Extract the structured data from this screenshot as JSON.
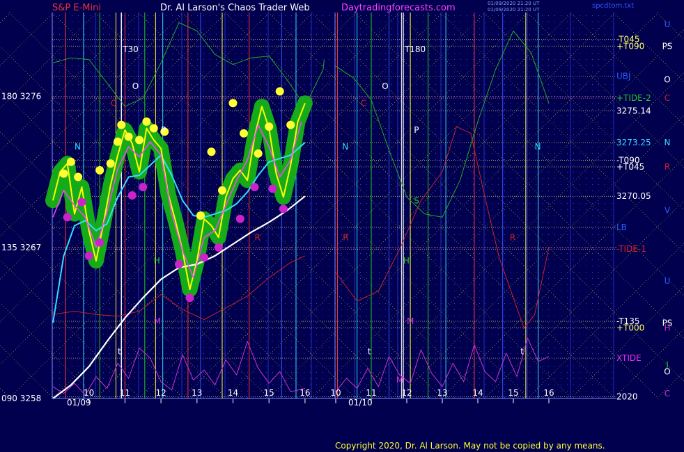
{
  "header": {
    "instrument": "S&P E-Mini",
    "site_title": "Dr. Al Larson's Chaos Trader Web",
    "site_url": "Daytradingforecasts.com",
    "timestamp_1": "01/09/2020 21:20 UT",
    "timestamp_2": "01/09/2020 21:20 UT",
    "spec_file": "spcdtom.txt"
  },
  "footer": {
    "copyright": "Copyright 2020, Dr. Al Larson. May not be copied by any means."
  },
  "colors": {
    "background": "#00004e",
    "grid_dot": "#3a46d8",
    "price": "#ffff00",
    "ma_fast": "#ff44ff",
    "ma_slow": "#33ddff",
    "long_ma": "#ffffff",
    "green_line": "#22aa22",
    "red_line": "#cc2222",
    "xtide": "#cc33cc",
    "dots_high": "#ffff33",
    "dots_low": "#cc22cc",
    "halo": "#16b316"
  },
  "chart_data": {
    "type": "line",
    "title": "S&P E-Mini",
    "xlabel": "",
    "ylabel": "",
    "ylim": [
      3258,
      3281
    ],
    "x_days": [
      "01/09",
      "01/10"
    ],
    "x_ticks": [
      {
        "label": "10",
        "x": 10
      },
      {
        "label": "11",
        "x": 11
      },
      {
        "label": "12",
        "x": 12
      },
      {
        "label": "13",
        "x": 13
      },
      {
        "label": "14",
        "x": 14
      },
      {
        "label": "15",
        "x": 15
      },
      {
        "label": "16",
        "x": 16
      },
      {
        "label": "10",
        "x": 26
      },
      {
        "label": "11",
        "x": 27
      },
      {
        "label": "12",
        "x": 28
      },
      {
        "label": "13",
        "x": 29
      },
      {
        "label": "14",
        "x": 30
      },
      {
        "label": "15",
        "x": 31
      },
      {
        "label": "16",
        "x": 32
      }
    ],
    "y_ticks": [
      {
        "label": "180  3276",
        "value": 3276
      },
      {
        "label": "135  3267",
        "value": 3267
      },
      {
        "label": "090  3258",
        "value": 3258
      }
    ],
    "vertical_labels": [
      {
        "label": "T30",
        "x": 10.9
      },
      {
        "label": "T180",
        "x": 27.9
      }
    ],
    "right_labels": [
      {
        "label": "-T045",
        "value": 3279.4,
        "color": "#ffff66"
      },
      {
        "label": "+T090",
        "value": 3279.0,
        "color": "#ffff66"
      },
      {
        "label": "UBJ",
        "value": 3277.2,
        "color": "#2a5cff"
      },
      {
        "label": "+TIDE-2",
        "value": 3275.9,
        "color": "#22cc22"
      },
      {
        "label": "3275.14",
        "value": 3275.14,
        "color": "#ffffff"
      },
      {
        "label": "3273.25",
        "value": 3273.25,
        "color": "#33ddff"
      },
      {
        "label": "-T090",
        "value": 3272.2,
        "color": "#ffffff"
      },
      {
        "label": "+T045",
        "value": 3271.8,
        "color": "#ffffff"
      },
      {
        "label": "3270.05",
        "value": 3270.05,
        "color": "#ffffff"
      },
      {
        "label": "LB",
        "value": 3268.2,
        "color": "#2a5cff"
      },
      {
        "label": "-TIDE-1",
        "value": 3266.9,
        "color": "#ee2222"
      },
      {
        "label": "-T135",
        "value": 3262.6,
        "color": "#ffffff"
      },
      {
        "label": "+T000",
        "value": 3262.2,
        "color": "#ffff66"
      },
      {
        "label": "XTIDE",
        "value": 3260.4,
        "color": "#ee33ee"
      },
      {
        "label": "2020",
        "value": 3258.1,
        "color": "#ffffff"
      }
    ],
    "far_right_labels": [
      {
        "label": "U",
        "value": 3280.3,
        "color": "#2a5cff"
      },
      {
        "label": "PS",
        "value": 3279.0,
        "color": "#ffffff"
      },
      {
        "label": "O",
        "value": 3277.0,
        "color": "#ffffff"
      },
      {
        "label": "C",
        "value": 3275.9,
        "color": "#cc2222"
      },
      {
        "label": "N",
        "value": 3273.25,
        "color": "#33ddff"
      },
      {
        "label": "R",
        "value": 3271.8,
        "color": "#cc2222"
      },
      {
        "label": "V",
        "value": 3269.2,
        "color": "#2a5cff"
      },
      {
        "label": "U",
        "value": 3265.0,
        "color": "#2a5cff"
      },
      {
        "label": "PS",
        "value": 3262.5,
        "color": "#ffffff"
      },
      {
        "label": "H",
        "value": 3262.2,
        "color": "#cc33cc"
      },
      {
        "label": "J",
        "value": 3260.0,
        "color": "#22cc22"
      },
      {
        "label": "O",
        "value": 3259.6,
        "color": "#ffffff"
      },
      {
        "label": "C",
        "value": 3258.3,
        "color": "#cc33cc"
      }
    ],
    "plot_letters": [
      {
        "label": "O",
        "x": 11.2,
        "value": 3276.6,
        "color": "#ffffff"
      },
      {
        "label": "P",
        "x": 12.0,
        "value": 3274.0,
        "color": "#ffffff"
      },
      {
        "label": "N",
        "x": 9.6,
        "value": 3273.0,
        "color": "#33ddff"
      },
      {
        "label": "C",
        "x": 10.6,
        "value": 3275.6,
        "color": "#cc2222"
      },
      {
        "label": "H",
        "x": 11.8,
        "value": 3266.2,
        "color": "#22cc22"
      },
      {
        "label": "M",
        "x": 11.8,
        "value": 3262.6,
        "color": "#cc33cc"
      },
      {
        "label": "R",
        "x": 14.6,
        "value": 3267.6,
        "color": "#cc2222"
      },
      {
        "label": "t",
        "x": 10.8,
        "value": 3260.8,
        "color": "#ffffff"
      },
      {
        "label": "O",
        "x": 27.3,
        "value": 3276.6,
        "color": "#ffffff"
      },
      {
        "label": "P",
        "x": 28.2,
        "value": 3274.0,
        "color": "#ffffff"
      },
      {
        "label": "N",
        "x": 25.6,
        "value": 3273.0,
        "color": "#33ddff"
      },
      {
        "label": "C",
        "x": 26.7,
        "value": 3275.6,
        "color": "#cc2222"
      },
      {
        "label": "S",
        "x": 28.2,
        "value": 3269.8,
        "color": "#22cc22"
      },
      {
        "label": "H",
        "x": 27.9,
        "value": 3266.2,
        "color": "#22cc22"
      },
      {
        "label": "M",
        "x": 28.0,
        "value": 3262.6,
        "color": "#cc33cc"
      },
      {
        "label": "R",
        "x": 25.9,
        "value": 3267.6,
        "color": "#cc2222"
      },
      {
        "label": "R",
        "x": 30.9,
        "value": 3267.6,
        "color": "#cc2222"
      },
      {
        "label": "t",
        "x": 31.2,
        "value": 3260.8,
        "color": "#ffffff"
      },
      {
        "label": "N",
        "x": 31.6,
        "value": 3273.0,
        "color": "#33ddff"
      },
      {
        "label": "t",
        "x": 26.9,
        "value": 3260.8,
        "color": "#ffffff"
      },
      {
        "label": "M",
        "x": 27.7,
        "value": 3259.1,
        "color": "#cc33cc"
      }
    ],
    "series": [
      {
        "name": "price",
        "x": [
          9.0,
          9.2,
          9.4,
          9.6,
          9.8,
          10.0,
          10.2,
          10.4,
          10.6,
          10.8,
          11.0,
          11.2,
          11.4,
          11.6,
          11.8,
          12.0,
          12.2,
          12.4,
          12.6,
          12.8,
          13.0,
          13.2,
          13.4,
          13.6,
          13.8,
          14.0,
          14.2,
          14.4,
          14.6,
          14.8,
          15.0,
          15.2,
          15.4,
          15.6,
          15.8,
          16.0
        ],
        "values": [
          3269.8,
          3271.5,
          3272.0,
          3269.0,
          3270.6,
          3268.0,
          3266.2,
          3268.4,
          3270.7,
          3272.5,
          3274.0,
          3273.2,
          3271.5,
          3274.1,
          3273.4,
          3272.9,
          3270.2,
          3268.6,
          3266.8,
          3264.5,
          3266.2,
          3268.7,
          3268.3,
          3267.6,
          3270.0,
          3271.1,
          3271.6,
          3271.0,
          3273.6,
          3275.4,
          3274.1,
          3271.4,
          3270.0,
          3271.9,
          3274.5,
          3275.6
        ]
      },
      {
        "name": "ma_fast",
        "x": [
          9.0,
          9.3,
          9.6,
          9.9,
          10.2,
          10.5,
          10.8,
          11.1,
          11.4,
          11.7,
          12.0,
          12.3,
          12.6,
          12.9,
          13.2,
          13.5,
          13.8,
          14.1,
          14.4,
          14.7,
          15.0,
          15.3,
          15.6,
          15.9
        ],
        "values": [
          3268.8,
          3270.4,
          3269.5,
          3268.8,
          3267.0,
          3269.1,
          3271.7,
          3273.0,
          3272.4,
          3273.3,
          3272.5,
          3269.0,
          3266.8,
          3265.2,
          3267.6,
          3268.0,
          3269.5,
          3271.0,
          3272.2,
          3274.3,
          3273.0,
          3271.2,
          3272.2,
          3274.5
        ]
      },
      {
        "name": "ma_slow",
        "x": [
          9.0,
          9.3,
          9.6,
          9.9,
          10.2,
          10.5,
          10.8,
          11.1,
          11.4,
          11.7,
          12.0,
          12.3,
          12.6,
          12.9,
          13.2,
          13.5,
          13.8,
          14.1,
          14.4,
          14.7,
          15.0,
          15.3,
          15.6,
          16.0
        ],
        "values": [
          3262.5,
          3266.5,
          3268.3,
          3268.6,
          3268.0,
          3268.4,
          3270.0,
          3271.2,
          3271.3,
          3271.9,
          3272.5,
          3271.3,
          3269.8,
          3268.9,
          3268.8,
          3269.0,
          3269.2,
          3269.6,
          3270.3,
          3271.3,
          3272.1,
          3272.3,
          3272.5,
          3273.25
        ]
      },
      {
        "name": "long_ma",
        "x": [
          9.0,
          9.5,
          10.0,
          10.5,
          11.0,
          11.5,
          12.0,
          12.5,
          13.0,
          13.5,
          14.0,
          14.5,
          15.0,
          15.5,
          16.0
        ],
        "values": [
          3258.0,
          3258.8,
          3259.9,
          3261.4,
          3262.8,
          3264.0,
          3265.1,
          3265.8,
          3266.0,
          3266.5,
          3267.2,
          3267.9,
          3268.5,
          3269.2,
          3270.05
        ]
      },
      {
        "name": "green",
        "x": [
          9.0,
          9.5,
          10.0,
          10.5,
          11.0,
          11.5,
          12.0,
          12.5,
          13.0,
          13.5,
          14.0,
          14.5,
          15.0,
          15.5,
          16.0,
          16.5,
          17.0,
          26.0,
          26.5,
          27.0,
          27.5,
          28.0,
          28.5,
          29.0,
          29.5,
          30.0,
          30.5,
          31.0,
          31.5,
          32.0
        ],
        "values": [
          3278.0,
          3278.3,
          3278.2,
          3276.8,
          3275.4,
          3275.9,
          3278.0,
          3280.4,
          3279.9,
          3278.5,
          3277.9,
          3278.3,
          3278.4,
          3277.0,
          3275.4,
          3277.6,
          3278.2,
          3277.8,
          3277.1,
          3275.8,
          3272.8,
          3270.0,
          3269.0,
          3268.8,
          3271.0,
          3274.5,
          3277.6,
          3279.9,
          3278.6,
          3275.6
        ]
      },
      {
        "name": "red",
        "x": [
          9.0,
          9.6,
          10.2,
          10.8,
          11.4,
          12.0,
          12.6,
          13.2,
          13.8,
          14.4,
          15.0,
          15.6,
          16.0,
          26.0,
          26.6,
          27.2,
          27.8,
          28.4,
          29.0,
          29.4,
          29.8,
          30.2,
          30.6,
          31.0,
          31.3,
          31.6,
          32.0
        ],
        "values": [
          3263.0,
          3263.2,
          3263.0,
          3262.9,
          3263.2,
          3264.2,
          3263.3,
          3262.7,
          3263.4,
          3264.1,
          3265.2,
          3266.1,
          3266.5,
          3265.5,
          3263.8,
          3264.4,
          3266.9,
          3269.8,
          3271.5,
          3274.2,
          3273.8,
          3270.0,
          3266.4,
          3264.0,
          3262.2,
          3263.0,
          3267.0
        ]
      },
      {
        "name": "xtide",
        "x": [
          9.0,
          9.3,
          9.6,
          9.9,
          10.2,
          10.5,
          10.8,
          11.1,
          11.4,
          11.7,
          12.0,
          12.3,
          12.6,
          12.9,
          13.2,
          13.5,
          13.8,
          14.1,
          14.4,
          14.7,
          15.0,
          15.3,
          15.6,
          16.0,
          26.0,
          26.3,
          26.6,
          26.9,
          27.2,
          27.5,
          27.8,
          28.1,
          28.4,
          28.7,
          29.0,
          29.3,
          29.6,
          29.9,
          30.2,
          30.5,
          30.8,
          31.1,
          31.4,
          31.7,
          32.0
        ],
        "values": [
          3258.7,
          3258.3,
          3258.9,
          3258.2,
          3259.3,
          3258.6,
          3260.1,
          3259.2,
          3261.0,
          3260.4,
          3259.0,
          3258.5,
          3260.6,
          3259.1,
          3259.7,
          3258.8,
          3260.3,
          3259.4,
          3261.4,
          3259.8,
          3258.9,
          3259.6,
          3258.4,
          3258.6,
          3258.4,
          3259.2,
          3258.6,
          3259.8,
          3258.7,
          3260.5,
          3259.4,
          3258.9,
          3260.9,
          3259.5,
          3258.7,
          3260.1,
          3259.0,
          3261.2,
          3259.6,
          3259.0,
          3260.7,
          3259.3,
          3261.6,
          3260.2,
          3260.5
        ]
      }
    ],
    "dots_high": [
      {
        "x": 9.3,
        "value": 3271.4
      },
      {
        "x": 9.5,
        "value": 3272.1
      },
      {
        "x": 9.7,
        "value": 3271.2
      },
      {
        "x": 10.3,
        "value": 3271.6
      },
      {
        "x": 10.6,
        "value": 3272.0
      },
      {
        "x": 10.8,
        "value": 3273.3
      },
      {
        "x": 10.9,
        "value": 3274.3
      },
      {
        "x": 11.1,
        "value": 3273.6
      },
      {
        "x": 11.4,
        "value": 3273.4
      },
      {
        "x": 11.6,
        "value": 3274.5
      },
      {
        "x": 11.8,
        "value": 3274.1
      },
      {
        "x": 12.1,
        "value": 3273.9
      },
      {
        "x": 13.1,
        "value": 3268.9
      },
      {
        "x": 13.4,
        "value": 3272.7
      },
      {
        "x": 13.7,
        "value": 3270.4
      },
      {
        "x": 14.0,
        "value": 3275.6
      },
      {
        "x": 14.3,
        "value": 3273.8
      },
      {
        "x": 14.7,
        "value": 3272.6
      },
      {
        "x": 15.0,
        "value": 3274.2
      },
      {
        "x": 15.3,
        "value": 3276.3
      },
      {
        "x": 15.6,
        "value": 3274.3
      }
    ],
    "dots_low": [
      {
        "x": 9.4,
        "value": 3268.8
      },
      {
        "x": 9.8,
        "value": 3269.7
      },
      {
        "x": 10.0,
        "value": 3266.5
      },
      {
        "x": 10.3,
        "value": 3267.3
      },
      {
        "x": 11.2,
        "value": 3270.1
      },
      {
        "x": 11.5,
        "value": 3270.6
      },
      {
        "x": 12.5,
        "value": 3266.0
      },
      {
        "x": 12.8,
        "value": 3264.0
      },
      {
        "x": 13.2,
        "value": 3266.4
      },
      {
        "x": 13.6,
        "value": 3267.0
      },
      {
        "x": 14.2,
        "value": 3268.7
      },
      {
        "x": 14.6,
        "value": 3270.6
      },
      {
        "x": 15.1,
        "value": 3270.5
      },
      {
        "x": 15.4,
        "value": 3269.3
      }
    ],
    "vertical_lines": [
      {
        "x": 9.35,
        "color": "#ff3333"
      },
      {
        "x": 9.85,
        "color": "#33ddff"
      },
      {
        "x": 10.3,
        "color": "#22cc22"
      },
      {
        "x": 10.75,
        "color": "#ffff33"
      },
      {
        "x": 11.0,
        "color": "#ff3333"
      },
      {
        "x": 11.55,
        "color": "#22cc22"
      },
      {
        "x": 11.85,
        "color": "#ffff33"
      },
      {
        "x": 12.05,
        "color": "#33ddff"
      },
      {
        "x": 12.75,
        "color": "#ff3333"
      },
      {
        "x": 13.1,
        "color": "#3355ff"
      },
      {
        "x": 13.7,
        "color": "#ffff33"
      },
      {
        "x": 14.45,
        "color": "#ff3333"
      },
      {
        "x": 15.35,
        "color": "#3355ff"
      },
      {
        "x": 15.75,
        "color": "#33ddff"
      },
      {
        "x": 26.05,
        "color": "#ff3333"
      },
      {
        "x": 26.6,
        "color": "#33ddff"
      },
      {
        "x": 27.0,
        "color": "#22cc22"
      },
      {
        "x": 27.5,
        "color": "#3355ff"
      },
      {
        "x": 27.85,
        "color": "#ffffff"
      },
      {
        "x": 28.1,
        "color": "#ffff33"
      },
      {
        "x": 28.6,
        "color": "#22cc22"
      },
      {
        "x": 29.1,
        "color": "#33ddff"
      },
      {
        "x": 29.9,
        "color": "#ff3333"
      },
      {
        "x": 30.7,
        "color": "#3355ff"
      },
      {
        "x": 31.35,
        "color": "#ffff33"
      },
      {
        "x": 31.7,
        "color": "#33ddff"
      }
    ]
  }
}
